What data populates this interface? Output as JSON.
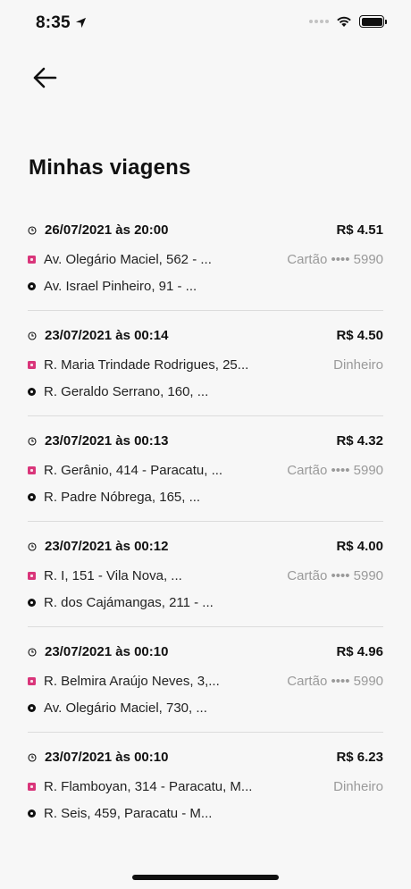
{
  "status_bar": {
    "time": "8:35"
  },
  "header": {
    "title": "Minhas viagens"
  },
  "trips": [
    {
      "datetime": "26/07/2021 às 20:00",
      "price": "R$ 4.51",
      "origin": "Av. Olegário Maciel, 562 - ...",
      "destination": "Av. Israel Pinheiro, 91 - ...",
      "payment": "Cartão •••• 5990"
    },
    {
      "datetime": "23/07/2021 às 00:14",
      "price": "R$ 4.50",
      "origin": "R. Maria Trindade Rodrigues, 25...",
      "destination": "R. Geraldo Serrano, 160, ...",
      "payment": "Dinheiro"
    },
    {
      "datetime": "23/07/2021 às 00:13",
      "price": "R$ 4.32",
      "origin": "R. Gerânio, 414 - Paracatu, ...",
      "destination": "R. Padre Nóbrega, 165, ...",
      "payment": "Cartão •••• 5990"
    },
    {
      "datetime": "23/07/2021 às 00:12",
      "price": "R$ 4.00",
      "origin": "R. I, 151 - Vila Nova, ...",
      "destination": "R. dos Cajámangas, 211 - ...",
      "payment": "Cartão •••• 5990"
    },
    {
      "datetime": "23/07/2021 às 00:10",
      "price": "R$ 4.96",
      "origin": "R. Belmira Araújo Neves, 3,...",
      "destination": "Av. Olegário Maciel, 730, ...",
      "payment": "Cartão •••• 5990"
    },
    {
      "datetime": "23/07/2021 às 00:10",
      "price": "R$ 6.23",
      "origin": "R. Flamboyan, 314 - Paracatu, M...",
      "destination": "R. Seis, 459, Paracatu - M...",
      "payment": "Dinheiro"
    }
  ],
  "colors": {
    "origin_marker": "#d9357a",
    "text_primary": "#111111",
    "text_secondary": "#9a9a9a",
    "background": "#f7f7f7"
  },
  "icons": {
    "back": "arrow-left-icon",
    "time": "clock-icon",
    "origin": "origin-square-icon",
    "destination": "destination-dot-icon"
  }
}
